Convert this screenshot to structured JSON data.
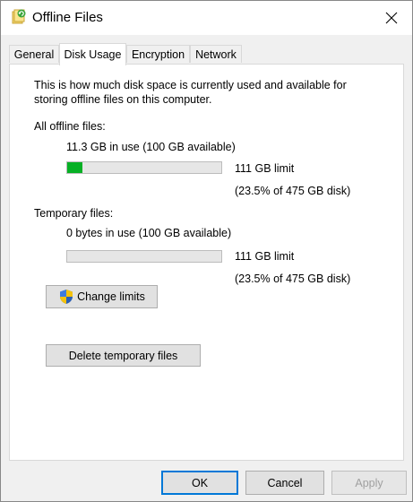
{
  "window": {
    "title": "Offline Files"
  },
  "tabs": [
    {
      "label": "General"
    },
    {
      "label": "Disk Usage"
    },
    {
      "label": "Encryption"
    },
    {
      "label": "Network"
    }
  ],
  "active_tab": "Disk Usage",
  "description": "This is how much disk space is currently used and available for storing offline files on this computer.",
  "description_lines": [
    "This is how much disk space is currently used and available for",
    "storing offline files on this computer."
  ],
  "all_files": {
    "heading": "All offline files:",
    "usage": "11.3 GB in use (100 GB available)",
    "usage_fraction": 0.1,
    "limit": "111 GB limit",
    "limit_detail": "(23.5% of 475 GB disk)"
  },
  "temp_files": {
    "heading": "Temporary files:",
    "usage": "0 bytes in use (100 GB available)",
    "usage_fraction": 0,
    "limit": "111 GB limit",
    "limit_detail": "(23.5% of 475 GB disk)"
  },
  "buttons": {
    "change_limits": "Change limits",
    "delete_temp": "Delete temporary files",
    "ok": "OK",
    "cancel": "Cancel",
    "apply": "Apply"
  },
  "colors": {
    "progress_fill": "#06b025",
    "accent": "#0078d7"
  },
  "icons": {
    "app": "offline-files-icon",
    "close": "close-icon",
    "uac": "uac-shield-icon"
  }
}
